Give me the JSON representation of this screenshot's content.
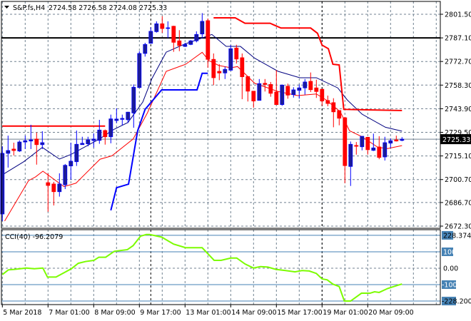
{
  "header": {
    "symbol": "S&P.fs,H4",
    "ohlc": "2724.58 2726.58 2724.08 2725.33"
  },
  "colors": {
    "bull_body": "#1c1c96",
    "bull_edge": "#0000ff",
    "bear": "#ff0000",
    "ma_fast": "#000080",
    "ma_slow": "#ff0000",
    "channel_low": "#0000ff",
    "channel_high": "#ff0000",
    "cci": "#7cfc00",
    "level": "#4682b4",
    "grid": "#708090"
  },
  "chart_data": [
    {
      "type": "candlestick",
      "title": "S&P.fs,H4",
      "ylim": [
        2672.3,
        2801.5
      ],
      "price_ticks": [
        "2801.50",
        "2787.10",
        "2772.70",
        "2758.30",
        "2743.90",
        "2729.50",
        "2715.10",
        "2700.70",
        "2686.70",
        "2672.30"
      ],
      "current_price": "2725.33",
      "horizontal_line": 2787.1,
      "time_labels": [
        {
          "i": 0,
          "label": "5 Mar 2018"
        },
        {
          "i": 8,
          "label": "7 Mar 01:00"
        },
        {
          "i": 16,
          "label": "8 Mar 09:00"
        },
        {
          "i": 24,
          "label": "9 Mar 17:00"
        },
        {
          "i": 32,
          "label": "13 Mar 01:00"
        },
        {
          "i": 40,
          "label": "14 Mar 09:00"
        },
        {
          "i": 48,
          "label": "15 Mar 17:00"
        },
        {
          "i": 56,
          "label": "19 Mar 01:00"
        },
        {
          "i": 64,
          "label": "20 Mar 09:00"
        }
      ],
      "separators": [
        26,
        56
      ],
      "ohlc": [
        [
          2679.7,
          2721.0,
          2675.4,
          2716.7
        ],
        [
          2716.7,
          2727.5,
          2708.0,
          2718.4
        ],
        [
          2719.3,
          2723.2,
          2715.4,
          2718.4
        ],
        [
          2718.1,
          2724.6,
          2717.5,
          2723.6
        ],
        [
          2723.6,
          2727.5,
          2719.3,
          2724.4
        ],
        [
          2724.2,
          2734.1,
          2719.3,
          2724.9
        ],
        [
          2725.4,
          2729.4,
          2709.8,
          2722.0
        ],
        [
          2722.0,
          2730.2,
          2719.3,
          2723.2
        ],
        [
          2698.8,
          2704.5,
          2681.1,
          2697.1
        ],
        [
          2698.0,
          2699.3,
          2684.9,
          2693.3
        ],
        [
          2693.3,
          2704.5,
          2690.3,
          2698.0
        ],
        [
          2697.5,
          2710.2,
          2694.9,
          2709.4
        ],
        [
          2709.0,
          2723.2,
          2700.7,
          2711.9
        ],
        [
          2711.6,
          2730.6,
          2709.0,
          2722.2
        ],
        [
          2722.0,
          2726.8,
          2721.9,
          2722.8
        ],
        [
          2722.5,
          2726.8,
          2721.0,
          2724.9
        ],
        [
          2724.5,
          2728.9,
          2720.2,
          2725.4
        ],
        [
          2724.6,
          2737.1,
          2722.5,
          2730.9
        ],
        [
          2730.6,
          2731.2,
          2722.0,
          2726.8
        ],
        [
          2726.8,
          2740.3,
          2722.8,
          2737.7
        ],
        [
          2736.7,
          2744.2,
          2735.2,
          2737.6
        ],
        [
          2737.4,
          2740.3,
          2733.8,
          2738.0
        ],
        [
          2737.2,
          2742.0,
          2735.2,
          2741.8
        ],
        [
          2741.3,
          2758.7,
          2732.3,
          2757.0
        ],
        [
          2756.8,
          2779.0,
          2756.6,
          2777.6
        ],
        [
          2777.6,
          2784.1,
          2775.7,
          2783.1
        ],
        [
          2783.8,
          2793.5,
          2783.7,
          2791.1
        ],
        [
          2790.9,
          2797.2,
          2790.3,
          2795.7
        ],
        [
          2795.7,
          2800.3,
          2790.2,
          2792.8
        ],
        [
          2793.2,
          2797.2,
          2787.0,
          2793.25
        ],
        [
          2794.2,
          2794.5,
          2778.6,
          2784.4
        ],
        [
          2785.3,
          2791.8,
          2779.0,
          2782.4
        ],
        [
          2781.9,
          2784.1,
          2781.5,
          2783.1
        ],
        [
          2783.1,
          2785.8,
          2782.7,
          2785.3
        ],
        [
          2785.3,
          2791.1,
          2784.4,
          2789.2
        ],
        [
          2789.5,
          2802.2,
          2787.3,
          2797.2
        ],
        [
          2797.6,
          2798.9,
          2768.9,
          2774.0
        ],
        [
          2774.0,
          2777.6,
          2758.3,
          2762.8
        ],
        [
          2766.7,
          2771.0,
          2761.3,
          2765.7
        ],
        [
          2765.7,
          2769.6,
          2762.0,
          2767.9
        ],
        [
          2767.4,
          2782.7,
          2767.0,
          2780.5
        ],
        [
          2780.9,
          2782.9,
          2771.4,
          2774.2
        ],
        [
          2775.0,
          2777.6,
          2749.7,
          2763.4
        ],
        [
          2763.5,
          2763.8,
          2748.3,
          2754.6
        ],
        [
          2754.6,
          2754.6,
          2744.5,
          2748.6
        ],
        [
          2749.0,
          2762.0,
          2749.0,
          2759.2
        ],
        [
          2759.4,
          2762.0,
          2754.4,
          2758.7
        ],
        [
          2758.7,
          2760.2,
          2751.2,
          2753.3
        ],
        [
          2754.1,
          2767.4,
          2746.4,
          2746.4
        ],
        [
          2746.4,
          2758.7,
          2745.7,
          2758.3
        ],
        [
          2757.6,
          2759.2,
          2750.0,
          2752.2
        ],
        [
          2752.5,
          2757.0,
          2750.7,
          2755.4
        ],
        [
          2755.1,
          2758.7,
          2750.0,
          2756.6
        ],
        [
          2756.6,
          2762.0,
          2752.5,
          2760.2
        ],
        [
          2760.6,
          2766.0,
          2754.1,
          2755.5
        ],
        [
          2756.6,
          2761.6,
          2750.5,
          2754.4
        ],
        [
          2755.8,
          2755.8,
          2745.7,
          2748.6
        ],
        [
          2748.9,
          2751.9,
          2745.4,
          2747.1
        ],
        [
          2747.6,
          2750.3,
          2732.6,
          2742.0
        ],
        [
          2742.8,
          2742.8,
          2733.8,
          2738.1
        ],
        [
          2738.4,
          2738.9,
          2698.5,
          2709.2
        ],
        [
          2708.7,
          2723.9,
          2696.8,
          2722.2
        ],
        [
          2721.5,
          2723.6,
          2715.9,
          2721.0
        ],
        [
          2720.7,
          2727.1,
          2718.5,
          2727.1
        ],
        [
          2726.5,
          2726.5,
          2715.9,
          2718.9
        ],
        [
          2718.5,
          2728.7,
          2718.1,
          2720.0
        ],
        [
          2720.6,
          2727.1,
          2713.1,
          2714.2
        ],
        [
          2714.5,
          2726.8,
          2712.3,
          2723.2
        ],
        [
          2722.9,
          2725.8,
          2720.0,
          2724.4
        ],
        [
          2724.9,
          2727.5,
          2723.9,
          2724.2
        ],
        [
          2724.58,
          2726.58,
          2724.08,
          2725.33
        ]
      ],
      "ma_fast": [
        [
          0,
          2703.6
        ],
        [
          3.75,
          2711.6
        ],
        [
          7,
          2720.3
        ],
        [
          10,
          2713.2
        ],
        [
          12,
          2716.0
        ],
        [
          17,
          2725.4
        ],
        [
          19.5,
          2731.2
        ],
        [
          22,
          2735.5
        ],
        [
          24.6,
          2748.0
        ],
        [
          26.2,
          2762.3
        ],
        [
          28.7,
          2778.4
        ],
        [
          32,
          2783.4
        ],
        [
          35.5,
          2787.7
        ],
        [
          36.7,
          2789.2
        ],
        [
          39.2,
          2781.9
        ],
        [
          41.7,
          2781.9
        ],
        [
          44.2,
          2774.7
        ],
        [
          48.3,
          2766.7
        ],
        [
          52.1,
          2762.8
        ],
        [
          55,
          2762.8
        ],
        [
          58.75,
          2756.6
        ],
        [
          60.4,
          2749.3
        ],
        [
          63,
          2740.6
        ],
        [
          67.1,
          2732.6
        ],
        [
          70,
          2730.2
        ]
      ],
      "ma_slow": [
        [
          0.4,
          2675.4
        ],
        [
          4.6,
          2700.1
        ],
        [
          5.8,
          2702.3
        ],
        [
          7.1,
          2705.8
        ],
        [
          10.8,
          2696.4
        ],
        [
          12.9,
          2698.5
        ],
        [
          17.1,
          2713.1
        ],
        [
          19.2,
          2715.2
        ],
        [
          22.9,
          2725.4
        ],
        [
          25.4,
          2741.3
        ],
        [
          28.7,
          2766.7
        ],
        [
          32.1,
          2771.0
        ],
        [
          35,
          2778.3
        ],
        [
          36.2,
          2773.2
        ],
        [
          37.9,
          2770.3
        ],
        [
          40,
          2768.9
        ],
        [
          41.2,
          2769.6
        ],
        [
          44.2,
          2759.4
        ],
        [
          48.3,
          2754.4
        ],
        [
          51.7,
          2751.9
        ],
        [
          55,
          2752.9
        ],
        [
          56.7,
          2749.3
        ],
        [
          59.2,
          2742.0
        ],
        [
          60.8,
          2730.5
        ],
        [
          63,
          2726.8
        ],
        [
          65.8,
          2720.3
        ],
        [
          67.5,
          2719.6
        ],
        [
          70,
          2721.4
        ]
      ],
      "channel_low": [
        [
          19,
          2681.9
        ],
        [
          20,
          2695.7
        ],
        [
          22.1,
          2697.9
        ],
        [
          23.7,
          2730.5
        ],
        [
          25,
          2743.5
        ],
        [
          27.9,
          2755.4
        ],
        [
          34.1,
          2755.4
        ],
        [
          35,
          2765.5
        ],
        [
          36,
          2765.5
        ]
      ],
      "channel_high": [
        [
          [
            0,
            2733.3
          ],
          [
            18,
            2733.3
          ]
        ],
        [
          [
            37,
            2799.3
          ],
          [
            40.8,
            2799.3
          ],
          [
            42.5,
            2796.0
          ],
          [
            46.9,
            2796.0
          ],
          [
            48.8,
            2793.1
          ],
          [
            54,
            2793.1
          ],
          [
            55.2,
            2789.9
          ],
          [
            56,
            2782.7
          ],
          [
            57.1,
            2780.5
          ],
          [
            57.9,
            2771.0
          ],
          [
            59,
            2770.6
          ],
          [
            59.8,
            2743.5
          ],
          [
            70,
            2742.8
          ]
        ]
      ]
    },
    {
      "type": "line",
      "title": "CCI(40) -96.2079",
      "levels": [
        {
          "v": 228.3744,
          "label": "228.3744"
        },
        {
          "v": 100,
          "label": "100"
        },
        {
          "v": 0,
          "label": "0.00"
        },
        {
          "v": -100,
          "label": "-100"
        },
        {
          "v": -228.2004,
          "label": "-228.2004"
        }
      ],
      "points": [
        [
          0,
          -39
        ],
        [
          1.05,
          -10
        ],
        [
          2.1,
          -7
        ],
        [
          4.2,
          1
        ],
        [
          5.6,
          -3
        ],
        [
          7.1,
          1
        ],
        [
          7.9,
          -54
        ],
        [
          9.4,
          -54
        ],
        [
          12.1,
          -3
        ],
        [
          13.3,
          30
        ],
        [
          14.6,
          41
        ],
        [
          16.05,
          48
        ],
        [
          16.9,
          67
        ],
        [
          18.1,
          67
        ],
        [
          19.6,
          104
        ],
        [
          21.9,
          117
        ],
        [
          22.9,
          148
        ],
        [
          24.2,
          222
        ],
        [
          25.2,
          235
        ],
        [
          25.8,
          235
        ],
        [
          27.9,
          215
        ],
        [
          30,
          160
        ],
        [
          32.1,
          132
        ],
        [
          35,
          132
        ],
        [
          37.1,
          48
        ],
        [
          38.3,
          48
        ],
        [
          40,
          62
        ],
        [
          41.05,
          62
        ],
        [
          42.5,
          26
        ],
        [
          44,
          1
        ],
        [
          45.2,
          10
        ],
        [
          46.5,
          7
        ],
        [
          47.9,
          -7
        ],
        [
          49.6,
          -14
        ],
        [
          51.25,
          -22
        ],
        [
          52.5,
          -14
        ],
        [
          53.75,
          -17
        ],
        [
          55,
          -32
        ],
        [
          56,
          -65
        ],
        [
          56.9,
          -71
        ],
        [
          57.9,
          -97
        ],
        [
          59,
          -115
        ],
        [
          59.9,
          -228
        ],
        [
          61,
          -228
        ],
        [
          62.9,
          -167
        ],
        [
          64.4,
          -167
        ],
        [
          65.2,
          -156
        ],
        [
          66,
          -161
        ],
        [
          67.5,
          -130
        ],
        [
          69.2,
          -106
        ],
        [
          70,
          -96.2
        ]
      ]
    }
  ]
}
